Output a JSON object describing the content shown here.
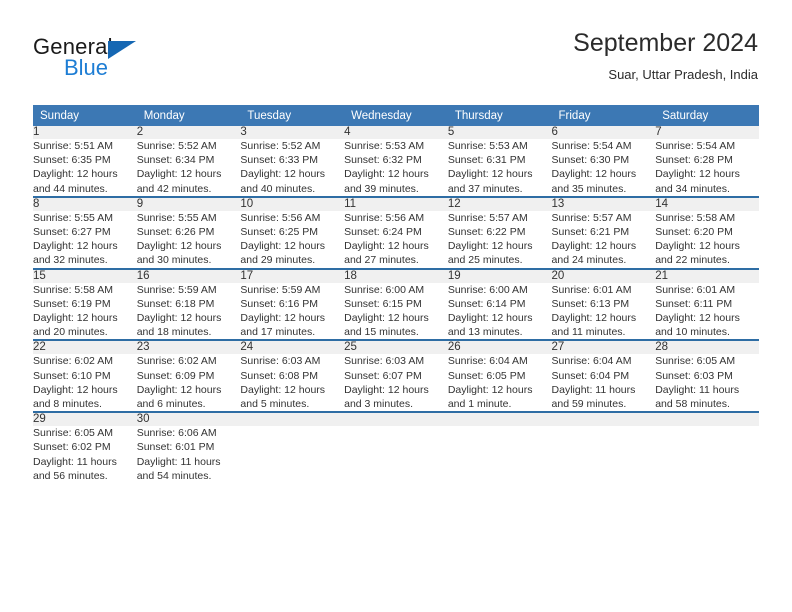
{
  "brand": {
    "name_part1": "General",
    "name_part2": "Blue",
    "triangle_color": "#1567b3",
    "blue_color": "#1d7dd4"
  },
  "header": {
    "title": "September 2024",
    "subtitle": "Suar, Uttar Pradesh, India"
  },
  "colors": {
    "header_row_bg": "#3c78b4",
    "week_separator": "#2e6da4",
    "daynum_bg": "#f0f0f0",
    "text": "#333333"
  },
  "weekdays": [
    "Sunday",
    "Monday",
    "Tuesday",
    "Wednesday",
    "Thursday",
    "Friday",
    "Saturday"
  ],
  "weeks": [
    [
      {
        "day": "1",
        "sunrise": "Sunrise: 5:51 AM",
        "sunset": "Sunset: 6:35 PM",
        "daylight1": "Daylight: 12 hours",
        "daylight2": "and 44 minutes."
      },
      {
        "day": "2",
        "sunrise": "Sunrise: 5:52 AM",
        "sunset": "Sunset: 6:34 PM",
        "daylight1": "Daylight: 12 hours",
        "daylight2": "and 42 minutes."
      },
      {
        "day": "3",
        "sunrise": "Sunrise: 5:52 AM",
        "sunset": "Sunset: 6:33 PM",
        "daylight1": "Daylight: 12 hours",
        "daylight2": "and 40 minutes."
      },
      {
        "day": "4",
        "sunrise": "Sunrise: 5:53 AM",
        "sunset": "Sunset: 6:32 PM",
        "daylight1": "Daylight: 12 hours",
        "daylight2": "and 39 minutes."
      },
      {
        "day": "5",
        "sunrise": "Sunrise: 5:53 AM",
        "sunset": "Sunset: 6:31 PM",
        "daylight1": "Daylight: 12 hours",
        "daylight2": "and 37 minutes."
      },
      {
        "day": "6",
        "sunrise": "Sunrise: 5:54 AM",
        "sunset": "Sunset: 6:30 PM",
        "daylight1": "Daylight: 12 hours",
        "daylight2": "and 35 minutes."
      },
      {
        "day": "7",
        "sunrise": "Sunrise: 5:54 AM",
        "sunset": "Sunset: 6:28 PM",
        "daylight1": "Daylight: 12 hours",
        "daylight2": "and 34 minutes."
      }
    ],
    [
      {
        "day": "8",
        "sunrise": "Sunrise: 5:55 AM",
        "sunset": "Sunset: 6:27 PM",
        "daylight1": "Daylight: 12 hours",
        "daylight2": "and 32 minutes."
      },
      {
        "day": "9",
        "sunrise": "Sunrise: 5:55 AM",
        "sunset": "Sunset: 6:26 PM",
        "daylight1": "Daylight: 12 hours",
        "daylight2": "and 30 minutes."
      },
      {
        "day": "10",
        "sunrise": "Sunrise: 5:56 AM",
        "sunset": "Sunset: 6:25 PM",
        "daylight1": "Daylight: 12 hours",
        "daylight2": "and 29 minutes."
      },
      {
        "day": "11",
        "sunrise": "Sunrise: 5:56 AM",
        "sunset": "Sunset: 6:24 PM",
        "daylight1": "Daylight: 12 hours",
        "daylight2": "and 27 minutes."
      },
      {
        "day": "12",
        "sunrise": "Sunrise: 5:57 AM",
        "sunset": "Sunset: 6:22 PM",
        "daylight1": "Daylight: 12 hours",
        "daylight2": "and 25 minutes."
      },
      {
        "day": "13",
        "sunrise": "Sunrise: 5:57 AM",
        "sunset": "Sunset: 6:21 PM",
        "daylight1": "Daylight: 12 hours",
        "daylight2": "and 24 minutes."
      },
      {
        "day": "14",
        "sunrise": "Sunrise: 5:58 AM",
        "sunset": "Sunset: 6:20 PM",
        "daylight1": "Daylight: 12 hours",
        "daylight2": "and 22 minutes."
      }
    ],
    [
      {
        "day": "15",
        "sunrise": "Sunrise: 5:58 AM",
        "sunset": "Sunset: 6:19 PM",
        "daylight1": "Daylight: 12 hours",
        "daylight2": "and 20 minutes."
      },
      {
        "day": "16",
        "sunrise": "Sunrise: 5:59 AM",
        "sunset": "Sunset: 6:18 PM",
        "daylight1": "Daylight: 12 hours",
        "daylight2": "and 18 minutes."
      },
      {
        "day": "17",
        "sunrise": "Sunrise: 5:59 AM",
        "sunset": "Sunset: 6:16 PM",
        "daylight1": "Daylight: 12 hours",
        "daylight2": "and 17 minutes."
      },
      {
        "day": "18",
        "sunrise": "Sunrise: 6:00 AM",
        "sunset": "Sunset: 6:15 PM",
        "daylight1": "Daylight: 12 hours",
        "daylight2": "and 15 minutes."
      },
      {
        "day": "19",
        "sunrise": "Sunrise: 6:00 AM",
        "sunset": "Sunset: 6:14 PM",
        "daylight1": "Daylight: 12 hours",
        "daylight2": "and 13 minutes."
      },
      {
        "day": "20",
        "sunrise": "Sunrise: 6:01 AM",
        "sunset": "Sunset: 6:13 PM",
        "daylight1": "Daylight: 12 hours",
        "daylight2": "and 11 minutes."
      },
      {
        "day": "21",
        "sunrise": "Sunrise: 6:01 AM",
        "sunset": "Sunset: 6:11 PM",
        "daylight1": "Daylight: 12 hours",
        "daylight2": "and 10 minutes."
      }
    ],
    [
      {
        "day": "22",
        "sunrise": "Sunrise: 6:02 AM",
        "sunset": "Sunset: 6:10 PM",
        "daylight1": "Daylight: 12 hours",
        "daylight2": "and 8 minutes."
      },
      {
        "day": "23",
        "sunrise": "Sunrise: 6:02 AM",
        "sunset": "Sunset: 6:09 PM",
        "daylight1": "Daylight: 12 hours",
        "daylight2": "and 6 minutes."
      },
      {
        "day": "24",
        "sunrise": "Sunrise: 6:03 AM",
        "sunset": "Sunset: 6:08 PM",
        "daylight1": "Daylight: 12 hours",
        "daylight2": "and 5 minutes."
      },
      {
        "day": "25",
        "sunrise": "Sunrise: 6:03 AM",
        "sunset": "Sunset: 6:07 PM",
        "daylight1": "Daylight: 12 hours",
        "daylight2": "and 3 minutes."
      },
      {
        "day": "26",
        "sunrise": "Sunrise: 6:04 AM",
        "sunset": "Sunset: 6:05 PM",
        "daylight1": "Daylight: 12 hours",
        "daylight2": "and 1 minute."
      },
      {
        "day": "27",
        "sunrise": "Sunrise: 6:04 AM",
        "sunset": "Sunset: 6:04 PM",
        "daylight1": "Daylight: 11 hours",
        "daylight2": "and 59 minutes."
      },
      {
        "day": "28",
        "sunrise": "Sunrise: 6:05 AM",
        "sunset": "Sunset: 6:03 PM",
        "daylight1": "Daylight: 11 hours",
        "daylight2": "and 58 minutes."
      }
    ],
    [
      {
        "day": "29",
        "sunrise": "Sunrise: 6:05 AM",
        "sunset": "Sunset: 6:02 PM",
        "daylight1": "Daylight: 11 hours",
        "daylight2": "and 56 minutes."
      },
      {
        "day": "30",
        "sunrise": "Sunrise: 6:06 AM",
        "sunset": "Sunset: 6:01 PM",
        "daylight1": "Daylight: 11 hours",
        "daylight2": "and 54 minutes."
      },
      {
        "day": "",
        "sunrise": "",
        "sunset": "",
        "daylight1": "",
        "daylight2": ""
      },
      {
        "day": "",
        "sunrise": "",
        "sunset": "",
        "daylight1": "",
        "daylight2": ""
      },
      {
        "day": "",
        "sunrise": "",
        "sunset": "",
        "daylight1": "",
        "daylight2": ""
      },
      {
        "day": "",
        "sunrise": "",
        "sunset": "",
        "daylight1": "",
        "daylight2": ""
      },
      {
        "day": "",
        "sunrise": "",
        "sunset": "",
        "daylight1": "",
        "daylight2": ""
      }
    ]
  ]
}
